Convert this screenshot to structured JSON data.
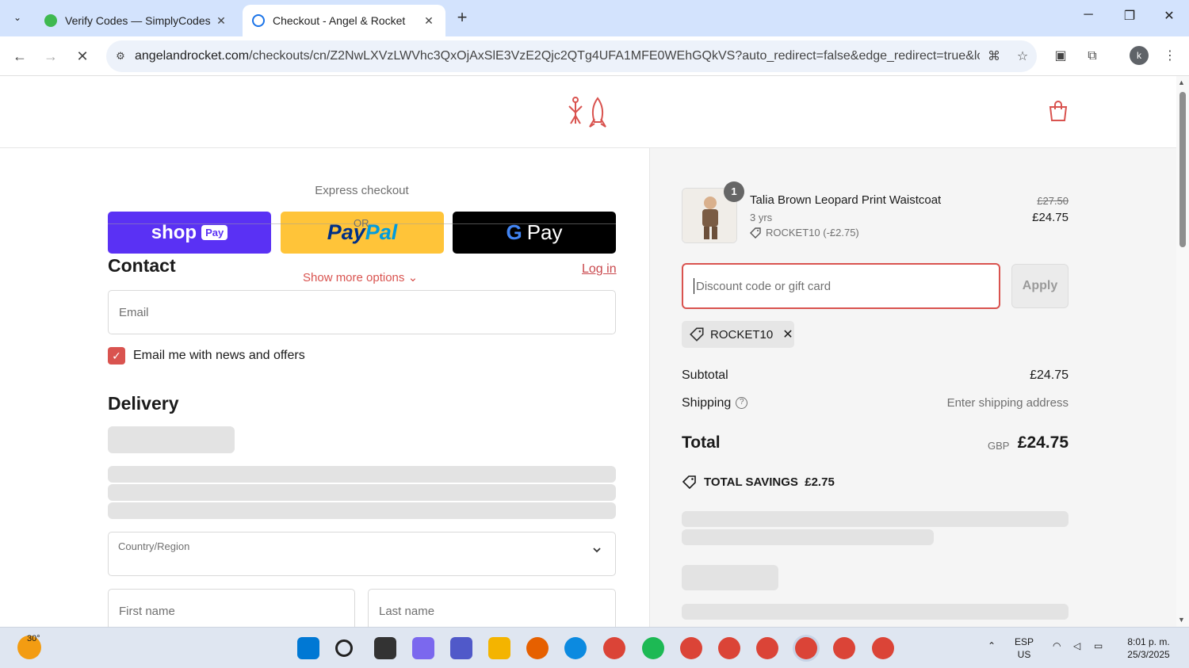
{
  "browser": {
    "tabs": [
      {
        "title": "Verify Codes — SimplyCodes",
        "active": false
      },
      {
        "title": "Checkout - Angel & Rocket",
        "active": true
      }
    ],
    "url_host": "angelandrocket.com",
    "url_path": "/checkouts/cn/Z2NwLXVzLWVhc3QxOjAxSlE3VzE2Qjc2QTg4UFA1MFE0WEhGQkVS?auto_redirect=false&edge_redirect=true&locale=...",
    "profile_initial": "k"
  },
  "checkout": {
    "express_title": "Express checkout",
    "shop_pay_label": "shop",
    "shop_pay_tag": "Pay",
    "paypal_label_1": "Pay",
    "paypal_label_2": "Pal",
    "gpay_label": "Pay",
    "gpay_g": "G",
    "or_text": "OR",
    "show_more": "Show more options ⌄",
    "contact_heading": "Contact",
    "login_link": "Log in",
    "email_placeholder": "Email",
    "news_checkbox_label": "Email me with news and offers",
    "delivery_heading": "Delivery",
    "country_label": "Country/Region",
    "first_name_placeholder": "First name",
    "last_name_placeholder": "Last name"
  },
  "summary": {
    "quantity": "1",
    "product_name": "Talia Brown Leopard Print Waistcoat",
    "variant": "3 yrs",
    "discount_line": "ROCKET10 (-£2.75)",
    "old_price": "£27.50",
    "new_price": "£24.75",
    "discount_placeholder": "Discount code or gift card",
    "apply_label": "Apply",
    "applied_code": "ROCKET10",
    "subtotal_label": "Subtotal",
    "subtotal_value": "£24.75",
    "shipping_label": "Shipping",
    "shipping_value": "Enter shipping address",
    "total_label": "Total",
    "currency": "GBP",
    "total_value": "£24.75",
    "savings_label": "TOTAL SAVINGS",
    "savings_value": "£2.75"
  },
  "taskbar": {
    "temperature": "30°",
    "lang_1": "ESP",
    "lang_2": "US",
    "time": "8:01 p. m.",
    "date": "25/3/2025"
  },
  "colors": {
    "accent": "#d9534f",
    "shop_pay": "#5a31f4",
    "paypal": "#ffc439"
  }
}
